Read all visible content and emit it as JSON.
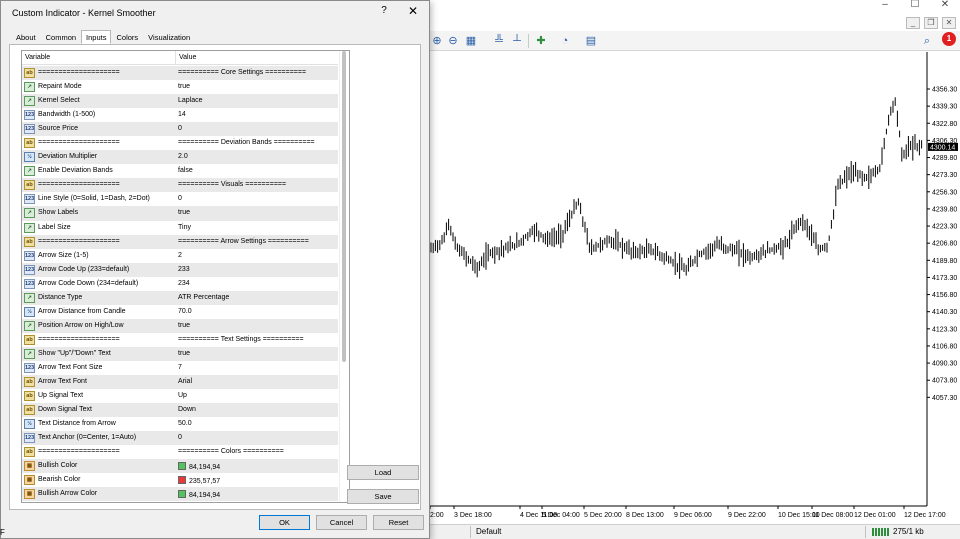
{
  "window": {
    "minimize": "–",
    "maximize": "☐",
    "close": "✕"
  },
  "mdi": {
    "minimize": "_",
    "restore": "❐",
    "close": "✕"
  },
  "toolbar": {
    "icons": [
      "zoom-in-icon",
      "zoom-out-icon",
      "tile-windows-icon",
      "period-separators-icon",
      "add-indicator-icon",
      "clock-icon",
      "templates-icon",
      "search-icon",
      "notifications-icon"
    ],
    "notification_count": "1"
  },
  "dialog": {
    "title": "Custom Indicator - Kernel Smoother",
    "help": "?",
    "close": "✕",
    "tabs": [
      "About",
      "Common",
      "Inputs",
      "Colors",
      "Visualization"
    ],
    "active_tab": "Inputs",
    "columns": {
      "variable": "Variable",
      "value": "Value"
    },
    "rows": [
      {
        "icon": "ab",
        "name": "====================",
        "value": "========== Core Settings =========="
      },
      {
        "icon": "arr",
        "name": "Repaint Mode",
        "value": "true"
      },
      {
        "icon": "arr",
        "name": "Kernel Select",
        "value": "Laplace"
      },
      {
        "icon": "123",
        "name": "Bandwidth (1-500)",
        "value": "14"
      },
      {
        "icon": "123",
        "name": "Source Price",
        "value": "0"
      },
      {
        "icon": "ab",
        "name": "====================",
        "value": "========== Deviation Bands =========="
      },
      {
        "icon": "dbl",
        "name": "Deviation Multiplier",
        "value": "2.0"
      },
      {
        "icon": "arr",
        "name": "Enable Deviation Bands",
        "value": "false"
      },
      {
        "icon": "ab",
        "name": "====================",
        "value": "========== Visuals =========="
      },
      {
        "icon": "123",
        "name": "Line Style (0=Solid, 1=Dash, 2=Dot)",
        "value": "0"
      },
      {
        "icon": "arr",
        "name": "Show Labels",
        "value": "true"
      },
      {
        "icon": "arr",
        "name": "Label Size",
        "value": "Tiny"
      },
      {
        "icon": "ab",
        "name": "====================",
        "value": "========== Arrow Settings =========="
      },
      {
        "icon": "123",
        "name": "Arrow Size (1-5)",
        "value": "2"
      },
      {
        "icon": "123",
        "name": "Arrow Code Up (233=default)",
        "value": "233"
      },
      {
        "icon": "123",
        "name": "Arrow Code Down (234=default)",
        "value": "234"
      },
      {
        "icon": "arr",
        "name": "Distance Type",
        "value": "ATR Percentage"
      },
      {
        "icon": "dbl",
        "name": "Arrow Distance from Candle",
        "value": "70.0"
      },
      {
        "icon": "arr",
        "name": "Position Arrow on High/Low",
        "value": "true"
      },
      {
        "icon": "ab",
        "name": "====================",
        "value": "========== Text Settings =========="
      },
      {
        "icon": "arr",
        "name": "Show \"Up\"/\"Down\" Text",
        "value": "true"
      },
      {
        "icon": "123",
        "name": "Arrow Text Font Size",
        "value": "7"
      },
      {
        "icon": "ab",
        "name": "Arrow Text Font",
        "value": "Arial"
      },
      {
        "icon": "ab",
        "name": "Up Signal Text",
        "value": "Up"
      },
      {
        "icon": "ab",
        "name": "Down Signal Text",
        "value": "Down"
      },
      {
        "icon": "dbl",
        "name": "Text Distance from Arrow",
        "value": "50.0"
      },
      {
        "icon": "123",
        "name": "Text Anchor (0=Center, 1=Auto)",
        "value": "0"
      },
      {
        "icon": "ab",
        "name": "====================",
        "value": "========== Colors =========="
      },
      {
        "icon": "col",
        "name": "Bullish Color",
        "value": "84,194,94",
        "swatch": "#54c25e"
      },
      {
        "icon": "col",
        "name": "Bearish Color",
        "value": "235,57,57",
        "swatch": "#eb3939"
      },
      {
        "icon": "col",
        "name": "Bullish Arrow Color",
        "value": "84,194,94",
        "swatch": "#54c25e"
      }
    ],
    "buttons": {
      "load": "Load",
      "save": "Save",
      "ok": "OK",
      "cancel": "Cancel",
      "reset": "Reset"
    }
  },
  "chart": {
    "price_labels": [
      "4356.30",
      "4339.30",
      "4322.80",
      "4306.30",
      "4289.80",
      "4273.30",
      "4256.30",
      "4239.80",
      "4223.30",
      "4206.80",
      "4189.80",
      "4173.30",
      "4156.80",
      "4140.30",
      "4123.30",
      "4106.80",
      "4090.30",
      "4073.80",
      "4057.30"
    ],
    "current_price": "4300.14",
    "time_labels": [
      "2:00",
      "3 Dec 18:00",
      "4 Dec 11:00",
      "5 Dec 04:00",
      "5 Dec 20:00",
      "8 Dec 13:00",
      "9 Dec 06:00",
      "9 Dec 22:00",
      "10 Dec 15:00",
      "11 Dec 08:00",
      "12 Dec 01:00",
      "12 Dec 17:00"
    ]
  },
  "status": {
    "left": "F",
    "profile": "Default",
    "traffic": "275/1 kb"
  }
}
